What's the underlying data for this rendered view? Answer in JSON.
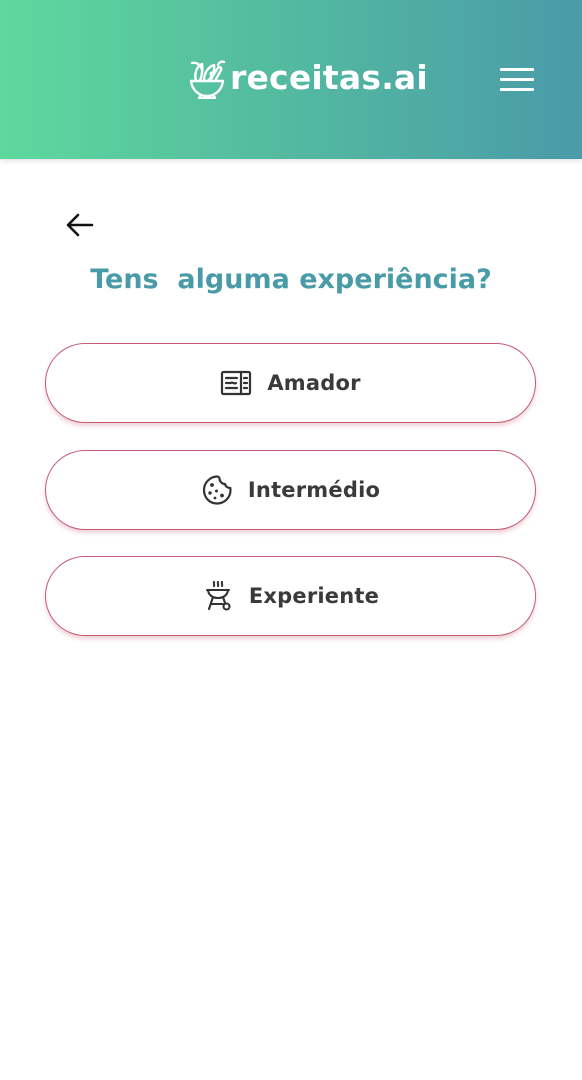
{
  "header": {
    "logo_text": "receitas.ai",
    "logo_icon": "salad-bowl-icon",
    "menu_icon": "hamburger-menu-icon",
    "gradient_start": "#5fd89d",
    "gradient_end": "#4a9ba8"
  },
  "navigation": {
    "back_icon": "arrow-left-icon"
  },
  "question": {
    "title": "Tens  alguma experiência?"
  },
  "options": [
    {
      "label": "Amador",
      "icon": "microwave-icon"
    },
    {
      "label": "Intermédio",
      "icon": "cookie-icon"
    },
    {
      "label": "Experiente",
      "icon": "grill-icon"
    }
  ],
  "colors": {
    "title": "#4a9ba8",
    "option_border": "#c65a72",
    "option_text": "#3a3a3a"
  }
}
